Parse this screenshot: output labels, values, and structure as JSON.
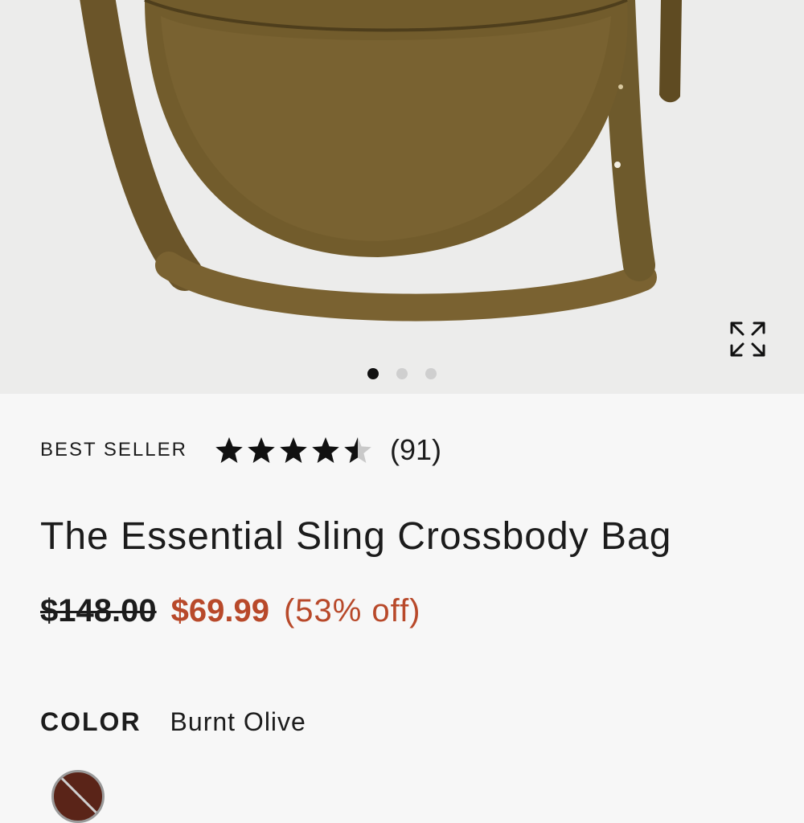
{
  "product": {
    "badge": "BEST SELLER",
    "rating": 4.5,
    "rating_max": 5,
    "review_count": "(91)",
    "title": "The Essential Sling Crossbody Bag",
    "original_price": "$148.00",
    "sale_price": "$69.99",
    "discount": "(53% off)"
  },
  "gallery": {
    "image_count": 3,
    "active_index": 0,
    "expand_icon": "expand-arrows-icon"
  },
  "color": {
    "label": "COLOR",
    "selected": "Burnt Olive",
    "swatches": [
      {
        "color": "#5a2418",
        "unavailable": true
      }
    ]
  },
  "colors": {
    "sale": "#b8492a",
    "bag": "#6f5a2e",
    "text": "#1c1c1c"
  }
}
